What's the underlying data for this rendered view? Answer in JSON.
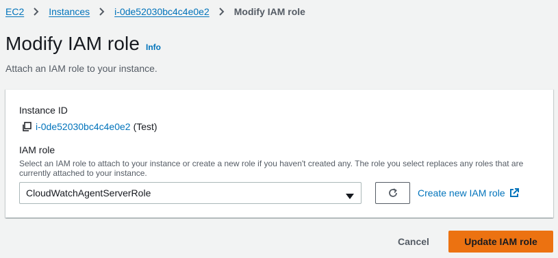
{
  "breadcrumb": {
    "items": [
      "EC2",
      "Instances",
      "i-0de52030bc4c4e0e2"
    ],
    "current": "Modify IAM role"
  },
  "page": {
    "title": "Modify IAM role",
    "info_label": "Info",
    "description": "Attach an IAM role to your instance."
  },
  "instance": {
    "label": "Instance ID",
    "id": "i-0de52030bc4c4e0e2",
    "name": "(Test)"
  },
  "iam_role": {
    "label": "IAM role",
    "help": "Select an IAM role to attach to your instance or create a new role if you haven't created any. The role you select replaces any roles that are currently attached to your instance.",
    "selected": "CloudWatchAgentServerRole",
    "create_link": "Create new IAM role"
  },
  "actions": {
    "cancel": "Cancel",
    "submit": "Update IAM role"
  },
  "colors": {
    "link": "#0073bb",
    "primary_button": "#ec7211",
    "background": "#f2f3f3"
  },
  "icons": [
    "chevron-right-icon",
    "copy-icon",
    "caret-down-icon",
    "refresh-icon",
    "external-link-icon"
  ]
}
